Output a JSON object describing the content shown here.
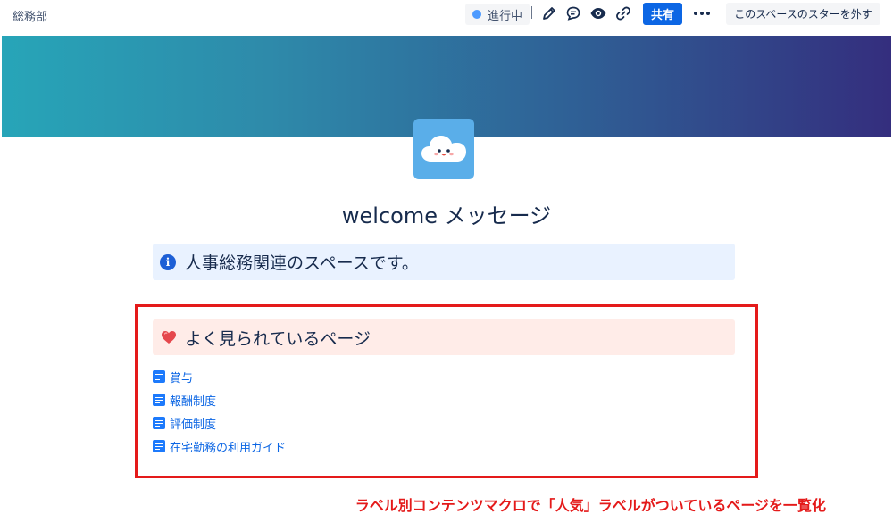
{
  "topbar": {
    "space_name": "総務部",
    "status_label": "進行中",
    "share_label": "共有",
    "unstar_label": "このスペースのスターを外す",
    "icons": [
      "edit-icon",
      "comment-icon",
      "watch-icon",
      "link-icon",
      "more-icon"
    ]
  },
  "page": {
    "title": "welcome メッセージ",
    "emoji": "cloud-face-emoji"
  },
  "info_panel": {
    "text": "人事総務関連のスペースです。",
    "icon": "info-icon"
  },
  "popular_panel": {
    "text": "よく見られているページ",
    "icon": "heart-icon"
  },
  "pages": [
    {
      "title": "賞与"
    },
    {
      "title": "報酬制度"
    },
    {
      "title": "評価制度"
    },
    {
      "title": "在宅勤務の利用ガイド"
    }
  ],
  "annotation": {
    "caption": "ラベル別コンテンツマクロで「人気」ラベルがついているページを一覧化"
  },
  "colors": {
    "accent_blue": "#0c66e4",
    "highlight_red": "#e41a1a",
    "info_bg": "#e9f2ff",
    "popular_bg": "#ffece8"
  }
}
